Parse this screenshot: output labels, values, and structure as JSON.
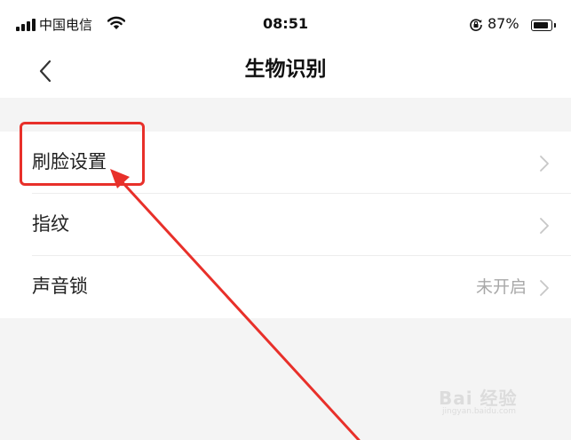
{
  "status_bar": {
    "carrier": "中国电信",
    "time": "08:51",
    "battery_percent": "87%",
    "battery_level": 0.87,
    "icons": [
      "signal-icon",
      "wifi-icon",
      "orientation-lock-icon",
      "battery-icon"
    ]
  },
  "nav": {
    "title": "生物识别",
    "back_icon": "chevron-left-icon"
  },
  "settings": {
    "items": [
      {
        "label": "刷脸设置",
        "value": "",
        "icon": "chevron-right-icon"
      },
      {
        "label": "指纹",
        "value": "",
        "icon": "chevron-right-icon"
      },
      {
        "label": "声音锁",
        "value": "未开启",
        "icon": "chevron-right-icon"
      }
    ]
  },
  "annotation": {
    "color": "#e8302a",
    "highlighted_item": "刷脸设置"
  },
  "watermark": {
    "text": "Bai 经验",
    "url": "jingyan.baidu.com"
  }
}
